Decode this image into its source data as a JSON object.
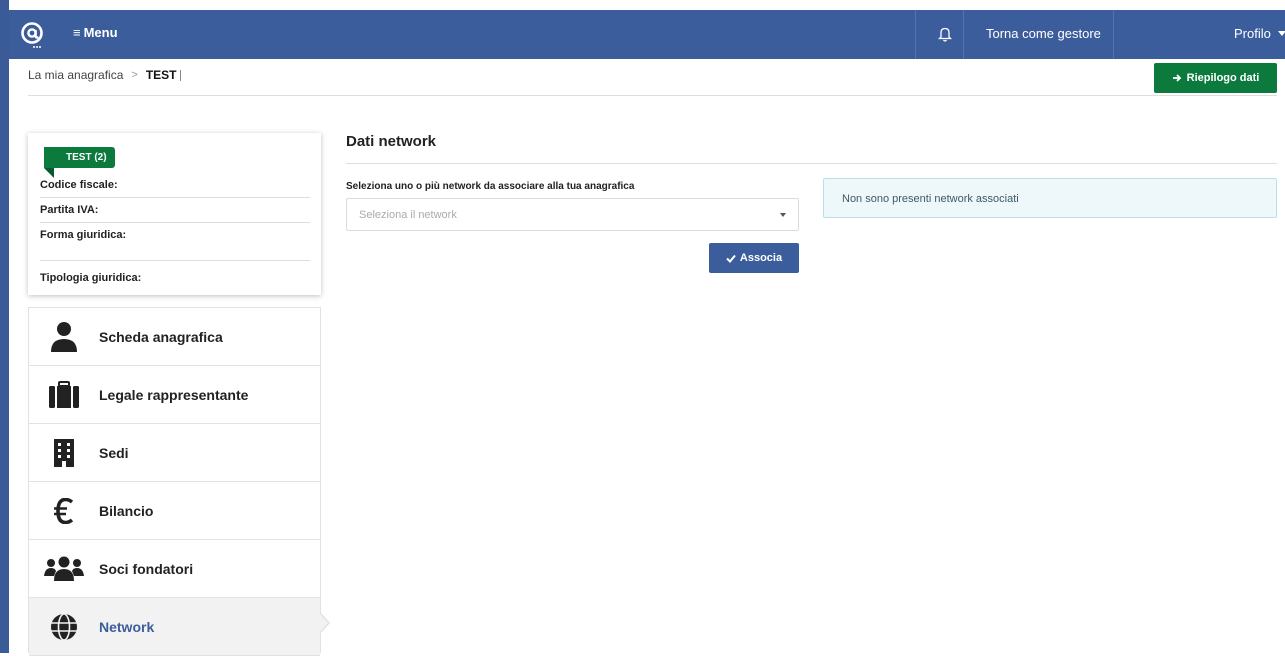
{
  "topbar": {
    "logo_icon": "at-sign-logo",
    "menu_label": "Menu",
    "menu_icon": "hamburger-icon",
    "bell_icon": "bell-icon",
    "torna_label": "Torna come gestore",
    "profilo_label": "Profilo",
    "color": "#3c5d9c"
  },
  "breadcrumb": {
    "items": [
      "La mia anagrafica",
      "TEST"
    ],
    "separator": ">"
  },
  "actions": {
    "riepilogo_label": "Riepilogo dati",
    "riepilogo_color": "#0b7a3c"
  },
  "entity_card": {
    "badge": "TEST (2)",
    "fields": [
      {
        "label": "Codice fiscale:",
        "value": ""
      },
      {
        "label": "Partita IVA:",
        "value": ""
      },
      {
        "label": "Forma giuridica:",
        "value": ""
      },
      {
        "label": "Tipologia giuridica:",
        "value": ""
      }
    ]
  },
  "sidebar": {
    "items": [
      {
        "label": "Scheda anagrafica",
        "icon": "user-icon",
        "active": false
      },
      {
        "label": "Legale rappresentante",
        "icon": "briefcase-icon",
        "active": false
      },
      {
        "label": "Sedi",
        "icon": "building-icon",
        "active": false
      },
      {
        "label": "Bilancio",
        "icon": "euro-icon",
        "active": false
      },
      {
        "label": "Soci fondatori",
        "icon": "users-icon",
        "active": false
      },
      {
        "label": "Network",
        "icon": "globe-icon",
        "active": true
      }
    ]
  },
  "main": {
    "title": "Dati network",
    "field_label": "Seleziona uno o più network da associare alla tua anagrafica",
    "select_placeholder": "Seleziona il network",
    "associa_label": "Associa",
    "alert_text": "Non sono presenti network associati"
  }
}
